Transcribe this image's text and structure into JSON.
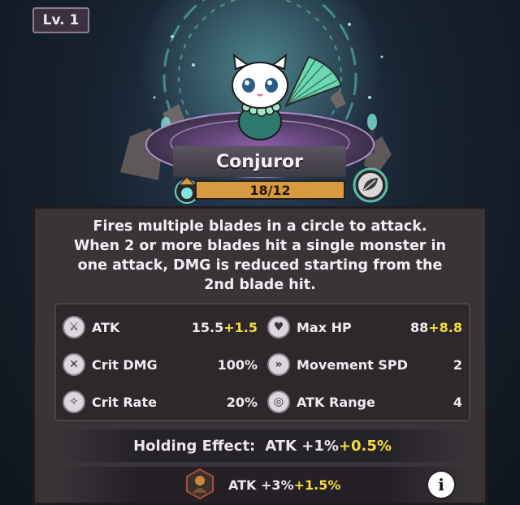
{
  "level": "Lv. 1",
  "character": {
    "name": "Conjuror",
    "progress_text": "18/12",
    "progress_fraction": 1.0
  },
  "description": "Fires multiple blades in a circle to attack.\nWhen 2 or more blades hit a single monster in\none attack, DMG is reduced starting from the\n2nd blade hit.",
  "stats": {
    "atk": {
      "label": "ATK",
      "base": "15.5",
      "bonus": "+1.5"
    },
    "max_hp": {
      "label": "Max HP",
      "base": "88",
      "bonus": "+8.8"
    },
    "crit_dmg": {
      "label": "Crit DMG",
      "value": "100%"
    },
    "movement_spd": {
      "label": "Movement SPD",
      "value": "2"
    },
    "crit_rate": {
      "label": "Crit Rate",
      "value": "20%"
    },
    "atk_range": {
      "label": "ATK Range",
      "value": "4"
    }
  },
  "holding_effect": {
    "label": "Holding Effect:",
    "stat": "ATK +1%",
    "bonus": "+0.5%"
  },
  "equip_effect": {
    "stat": "ATK +3%",
    "bonus": "+1.5%"
  },
  "info_label": "i",
  "colors": {
    "bonus": "#f4dc3a",
    "progress": "#d89a3e",
    "magic_circle": "#6fd3d0"
  }
}
